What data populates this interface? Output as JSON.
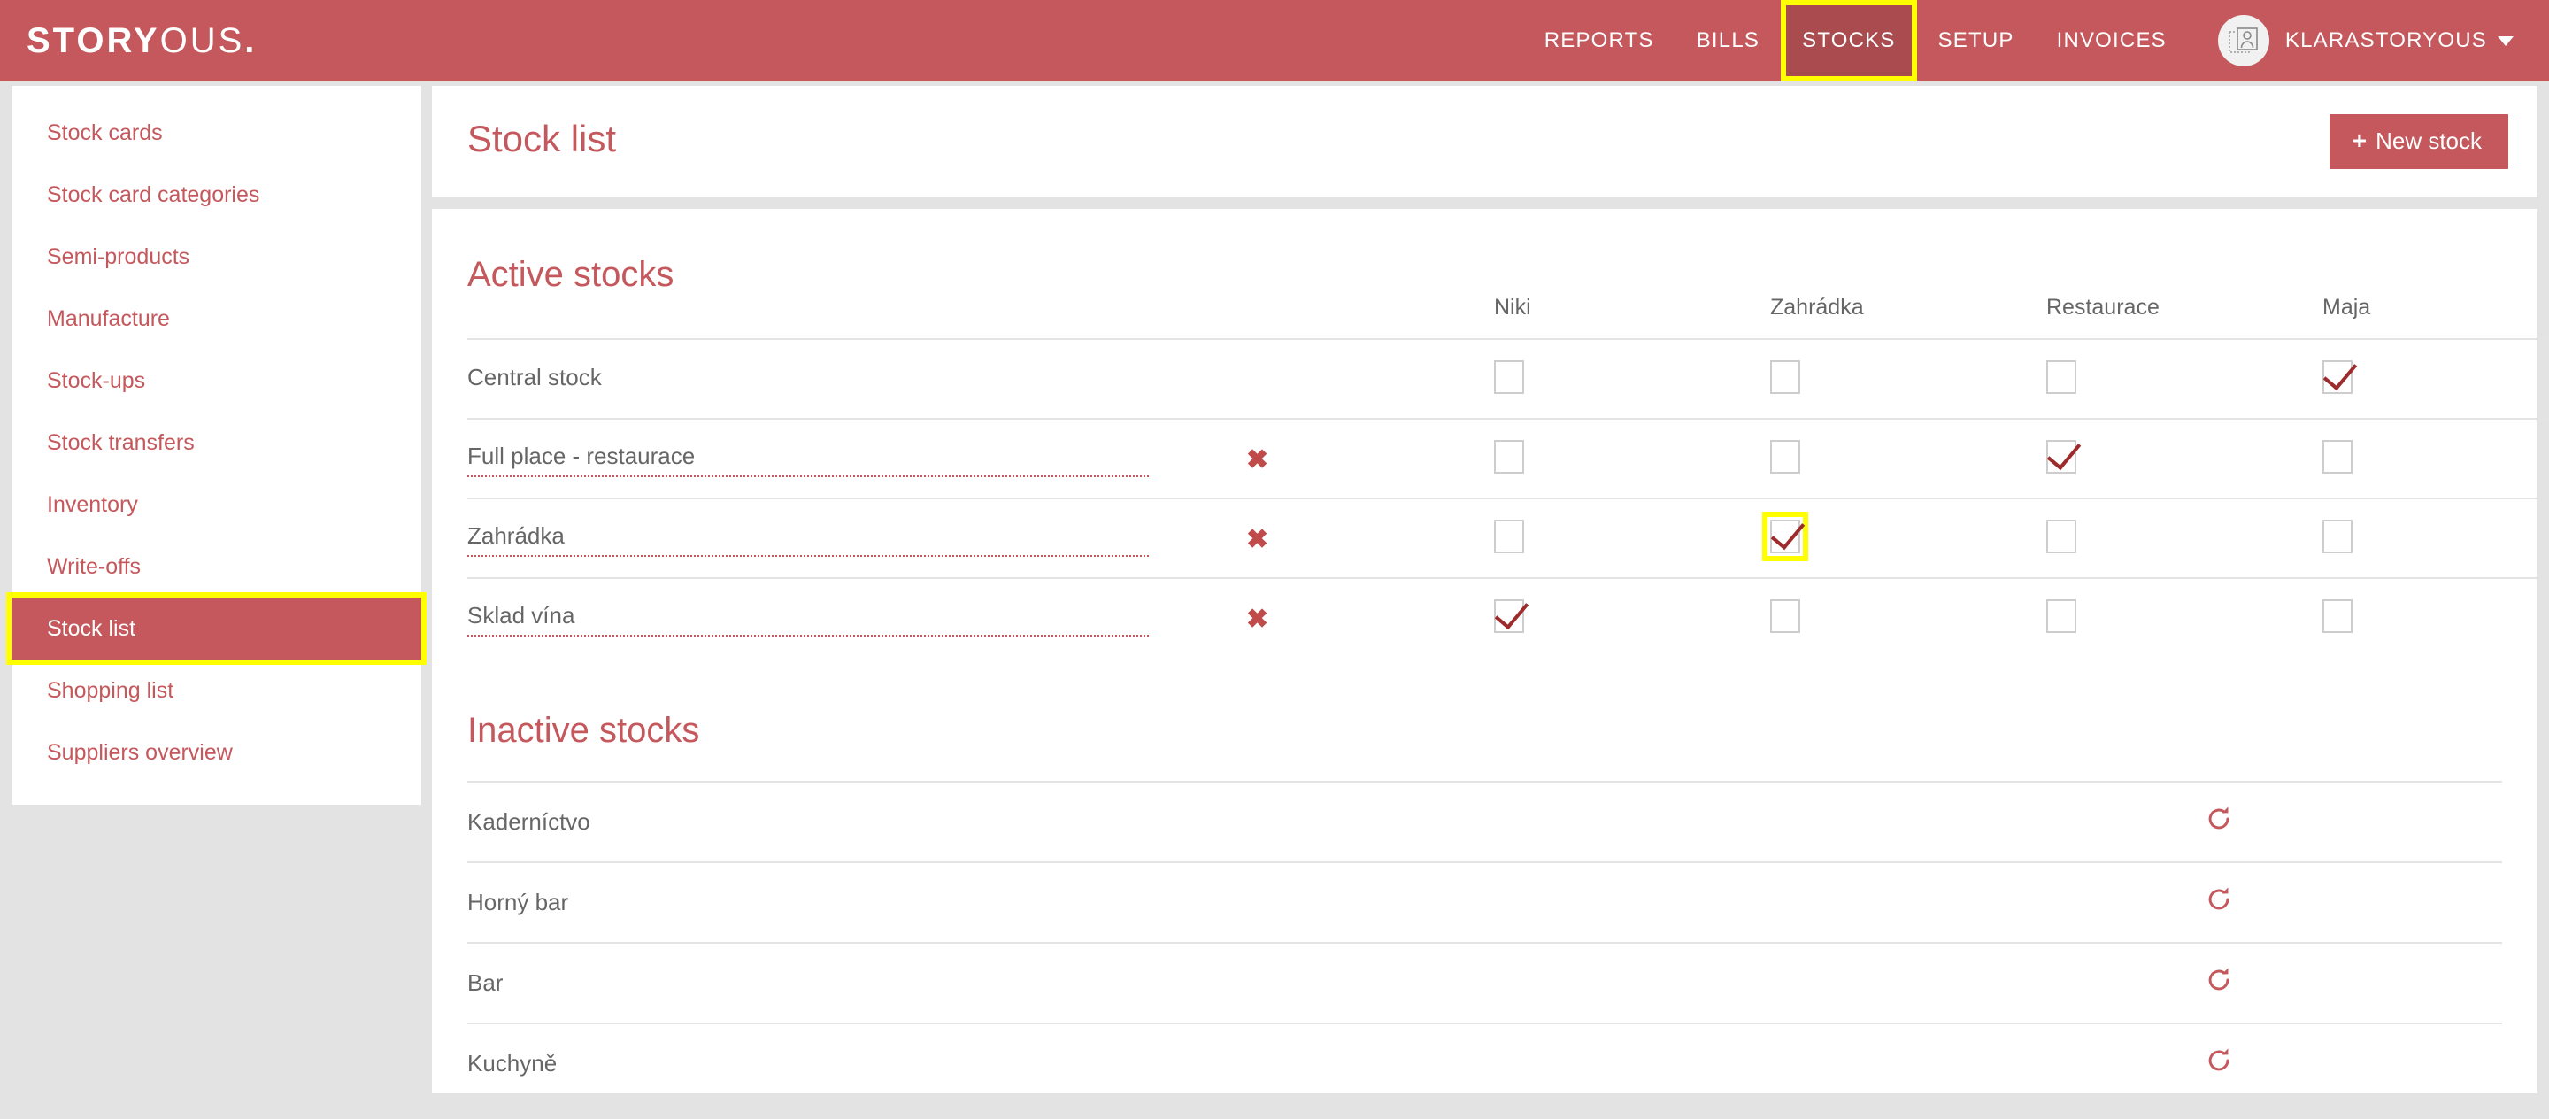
{
  "brand": {
    "logo_bold": "STORY",
    "logo_light": "OUS",
    "logo_dot": ".",
    "accent_color": "#c4585c",
    "active_nav_color": "#a94b4f",
    "highlight_color": "#ffff00",
    "check_color": "#9e2b2b",
    "text_color": "#666666"
  },
  "topnav": {
    "items": [
      {
        "label": "REPORTS",
        "active": false
      },
      {
        "label": "BILLS",
        "active": false
      },
      {
        "label": "STOCKS",
        "active": true
      },
      {
        "label": "SETUP",
        "active": false
      },
      {
        "label": "INVOICES",
        "active": false
      }
    ],
    "user": {
      "name": "KLARASTORYOUS",
      "avatar_icon": "user-photo-placeholder-icon",
      "caret_icon": "chevron-down-icon"
    }
  },
  "sidebar": {
    "items": [
      {
        "label": "Stock cards",
        "active": false
      },
      {
        "label": "Stock card categories",
        "active": false
      },
      {
        "label": "Semi-products",
        "active": false
      },
      {
        "label": "Manufacture",
        "active": false
      },
      {
        "label": "Stock-ups",
        "active": false
      },
      {
        "label": "Stock transfers",
        "active": false
      },
      {
        "label": "Inventory",
        "active": false
      },
      {
        "label": "Write-offs",
        "active": false
      },
      {
        "label": "Stock list",
        "active": true
      },
      {
        "label": "Shopping list",
        "active": false
      },
      {
        "label": "Suppliers overview",
        "active": false
      }
    ]
  },
  "header": {
    "title": "Stock list",
    "new_stock_plus": "+",
    "new_stock_label": "New stock"
  },
  "active_section": {
    "title": "Active stocks",
    "columns": [
      "Niki",
      "Zahrádka",
      "Restaurace",
      "Maja"
    ],
    "delete_icon": "✖",
    "rows": [
      {
        "name": "Central stock",
        "editable": false,
        "deletable": false,
        "checks": [
          false,
          false,
          false,
          true
        ]
      },
      {
        "name": "Full place - restaurace",
        "editable": true,
        "deletable": true,
        "checks": [
          false,
          false,
          true,
          false
        ]
      },
      {
        "name": "Zahrádka",
        "editable": true,
        "deletable": true,
        "checks": [
          false,
          true,
          false,
          false
        ]
      },
      {
        "name": "Sklad vína",
        "editable": true,
        "deletable": true,
        "checks": [
          true,
          false,
          false,
          false
        ]
      }
    ]
  },
  "inactive_section": {
    "title": "Inactive stocks",
    "restore_icon": "restore-icon",
    "rows": [
      {
        "name": "Kaderníctvo"
      },
      {
        "name": "Horný bar"
      },
      {
        "name": "Bar"
      },
      {
        "name": "Kuchyně"
      }
    ]
  }
}
